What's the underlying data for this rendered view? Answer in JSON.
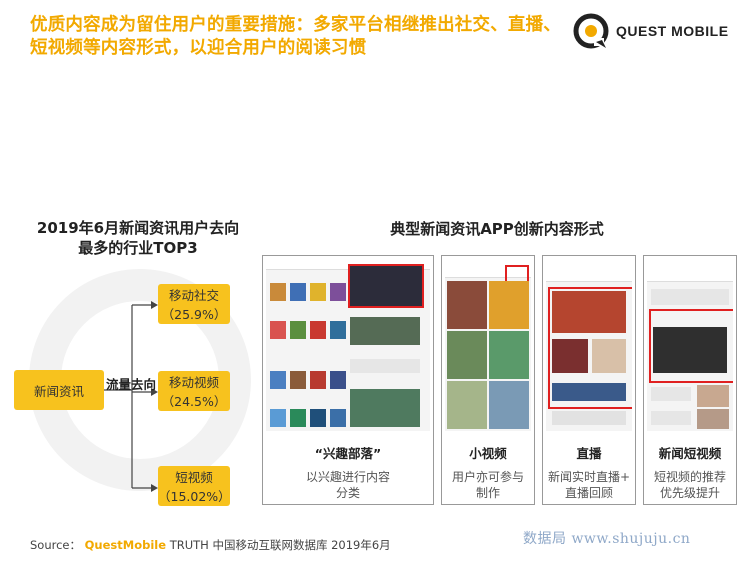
{
  "header": {
    "title": "优质内容成为留住用户的重要措施：多家平台相继推出社交、直播、短视频等内容形式，以迎合用户的阅读习惯",
    "logo_text": "QUEST MOBILE"
  },
  "left": {
    "heading_line1": "2019年6月新闻资讯用户去向",
    "heading_line2": "最多的行业TOP3",
    "source_box": "新闻资讯",
    "flow_label": "流量去向",
    "destinations": [
      {
        "label": "移动社交",
        "value": "（25.9%）"
      },
      {
        "label": "移动视频",
        "value": "（24.5%）"
      },
      {
        "label": "短视频",
        "value": "（15.02%）"
      }
    ]
  },
  "right": {
    "heading": "典型新闻资讯APP创新内容形式",
    "panels": [
      {
        "title": "“兴趣部落”",
        "desc_line1": "以兴趣进行内容",
        "desc_line2": "分类"
      },
      {
        "title": "小视频",
        "desc_line1": "用户亦可参与",
        "desc_line2": "制作"
      },
      {
        "title": "直播",
        "desc_line1": "新闻实时直播+",
        "desc_line2": "直播回顾"
      },
      {
        "title": "新闻短视频",
        "desc_line1": "短视频的推荐",
        "desc_line2": "优先级提升"
      }
    ]
  },
  "footer": {
    "source_label": "Source：",
    "source_brand": "QuestMobile",
    "source_text": "TRUTH 中国移动互联网数据库 2019年6月",
    "watermark": "数据局 www.shujuju.cn"
  },
  "colors": {
    "accent": "#f2a900",
    "box": "#f7c21e",
    "highlight": "#e02020"
  }
}
